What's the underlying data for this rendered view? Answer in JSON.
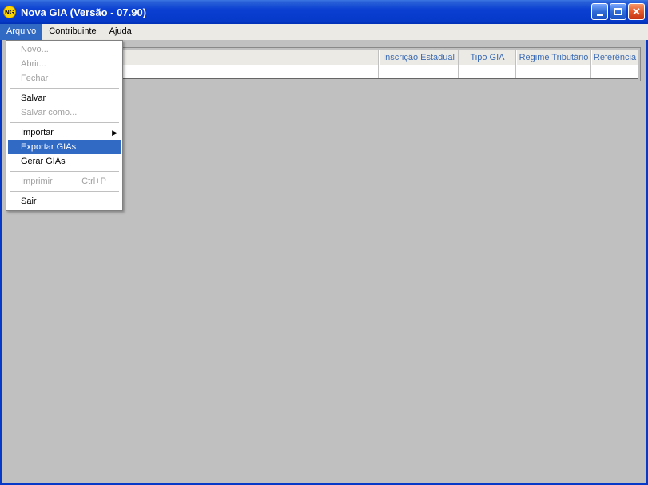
{
  "window": {
    "title": "Nova GIA (Versão - 07.90)",
    "icon_text": "NG"
  },
  "menubar": {
    "arquivo": "Arquivo",
    "contribuinte": "Contribuinte",
    "ajuda": "Ajuda"
  },
  "dropdown": {
    "novo": "Novo...",
    "abrir": "Abrir...",
    "fechar": "Fechar",
    "salvar": "Salvar",
    "salvar_como": "Salvar como...",
    "importar": "Importar",
    "exportar_gias": "Exportar GIAs",
    "gerar_gias": "Gerar GIAs",
    "imprimir": "Imprimir",
    "imprimir_shortcut": "Ctrl+P",
    "sair": "Sair"
  },
  "table": {
    "headers": {
      "inscricao": "Inscrição Estadual",
      "tipo": "Tipo GIA",
      "regime": "Regime Tributário",
      "referencia": "Referência"
    }
  }
}
